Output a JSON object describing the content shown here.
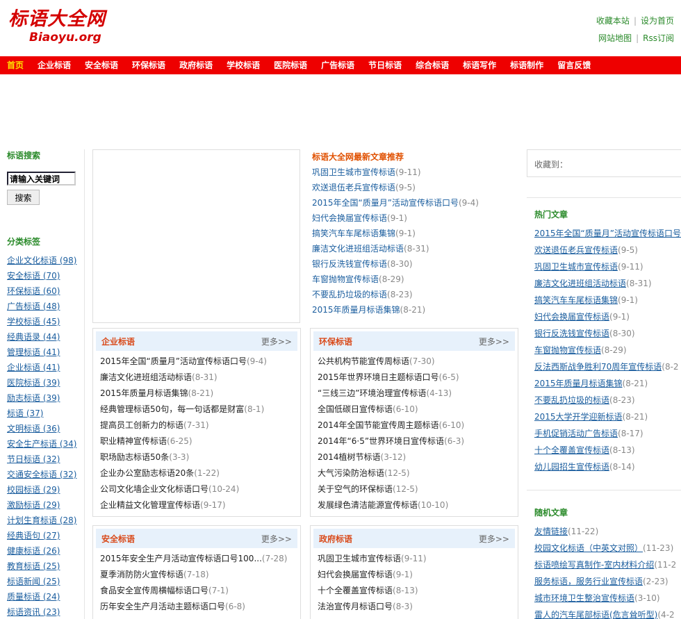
{
  "header": {
    "logo_cn": "标语大全网",
    "logo_en": "Biaoyu.org",
    "links": [
      "收藏本站",
      "设为首页",
      "网站地图",
      "Rss订阅"
    ]
  },
  "nav": [
    "首页",
    "企业标语",
    "安全标语",
    "环保标语",
    "政府标语",
    "学校标语",
    "医院标语",
    "广告标语",
    "节日标语",
    "综合标语",
    "标语写作",
    "标语制作",
    "留言反馈"
  ],
  "left": {
    "search_title": "标语搜索",
    "search_value": "请输入关键词",
    "search_button": "搜索",
    "tags_title": "分类标签",
    "tags": [
      "企业文化标语 (98)",
      "安全标语 (70)",
      "环保标语 (60)",
      "广告标语 (48)",
      "学校标语 (45)",
      "经典语录 (44)",
      "管理标语 (41)",
      "企业标语 (41)",
      "医院标语 (39)",
      "励志标语 (39)",
      "标语 (37)",
      "文明标语 (36)",
      "安全生产标语 (34)",
      "节日标语 (32)",
      "交通安全标语 (32)",
      "校园标语 (29)",
      "激励标语 (29)",
      "计划生育标语 (28)",
      "经典语句 (27)",
      "健康标语 (26)",
      "教育标语 (25)",
      "标语新闻 (25)",
      "质量标语 (24)",
      "标语资讯 (23)"
    ]
  },
  "latest": {
    "title": "标语大全网最新文章推荐",
    "items": [
      {
        "t": "巩固卫生城市宣传标语",
        "d": "(9-11)"
      },
      {
        "t": "欢送退伍老兵宣传标语",
        "d": "(9-5)"
      },
      {
        "t": "2015年全国“质量月”活动宣传标语口号",
        "d": "(9-4)"
      },
      {
        "t": "妇代会换届宣传标语",
        "d": "(9-1)"
      },
      {
        "t": "搞笑汽车车尾标语集锦",
        "d": "(9-1)"
      },
      {
        "t": "廉洁文化进班组活动标语",
        "d": "(8-31)"
      },
      {
        "t": "银行反洗钱宣传标语",
        "d": "(8-30)"
      },
      {
        "t": "车窗抛物宣传标语",
        "d": "(8-29)"
      },
      {
        "t": "不要乱扔垃圾的标语",
        "d": "(8-23)"
      },
      {
        "t": "2015年质量月标语集锦",
        "d": "(8-21)"
      }
    ]
  },
  "panels": {
    "more": "更多>>",
    "qiye": {
      "title": "企业标语",
      "items": [
        {
          "t": "2015年全国“质量月”活动宣传标语口号",
          "d": "(9-4)"
        },
        {
          "t": "廉洁文化进班组活动标语",
          "d": "(8-31)"
        },
        {
          "t": "2015年质量月标语集锦",
          "d": "(8-21)"
        },
        {
          "t": "经典管理标语50句，每一句话都是财富",
          "d": "(8-1)"
        },
        {
          "t": "提高员工创新力的标语",
          "d": "(7-31)"
        },
        {
          "t": "职业精神宣传标语",
          "d": "(6-25)"
        },
        {
          "t": "职场励志标语50条",
          "d": "(3-3)"
        },
        {
          "t": "企业办公室励志标语20条",
          "d": "(1-22)"
        },
        {
          "t": "公司文化墙企业文化标语口号",
          "d": "(10-24)"
        },
        {
          "t": "企业精益文化管理宣传标语",
          "d": "(9-17)"
        }
      ]
    },
    "huanbao": {
      "title": "环保标语",
      "items": [
        {
          "t": "公共机构节能宣传周标语",
          "d": "(7-30)"
        },
        {
          "t": "2015年世界环境日主题标语口号",
          "d": "(6-5)"
        },
        {
          "t": "“三线三边”环境治理宣传标语",
          "d": "(4-13)"
        },
        {
          "t": "全国低碳日宣传标语",
          "d": "(6-10)"
        },
        {
          "t": "2014年全国节能宣传周主题标语",
          "d": "(6-10)"
        },
        {
          "t": "2014年“6·5”世界环境日宣传标语",
          "d": "(6-3)"
        },
        {
          "t": "2014植树节标语",
          "d": "(3-12)"
        },
        {
          "t": "大气污染防治标语",
          "d": "(12-5)"
        },
        {
          "t": "关于空气的环保标语",
          "d": "(12-5)"
        },
        {
          "t": "发展绿色清洁能源宣传标语",
          "d": "(10-10)"
        }
      ]
    },
    "anquan": {
      "title": "安全标语",
      "items": [
        {
          "t": "2015年安全生产月活动宣传标语口号100...",
          "d": "(7-28)"
        },
        {
          "t": "夏季消防防火宣传标语",
          "d": "(7-18)"
        },
        {
          "t": "食品安全宣传周横幅标语口号",
          "d": "(7-1)"
        },
        {
          "t": "历年安全生产月活动主题标语口号",
          "d": "(6-8)"
        }
      ]
    },
    "zhengfu": {
      "title": "政府标语",
      "items": [
        {
          "t": "巩固卫生城市宣传标语",
          "d": "(9-11)"
        },
        {
          "t": "妇代会换届宣传标语",
          "d": "(9-1)"
        },
        {
          "t": "十个全覆盖宣传标语",
          "d": "(8-13)"
        },
        {
          "t": "法治宣传月标语口号",
          "d": "(8-3)"
        }
      ]
    }
  },
  "right": {
    "fav_label": "收藏到：",
    "hot_title": "热门文章",
    "hot": [
      {
        "t": "2015年全国“质量月”活动宣传标语口号",
        "d": ""
      },
      {
        "t": "欢送退伍老兵宣传标语",
        "d": "(9-5)"
      },
      {
        "t": "巩固卫生城市宣传标语",
        "d": "(9-11)"
      },
      {
        "t": "廉洁文化进班组活动标语",
        "d": "(8-31)"
      },
      {
        "t": "搞笑汽车车尾标语集锦",
        "d": "(9-1)"
      },
      {
        "t": "妇代会换届宣传标语",
        "d": "(9-1)"
      },
      {
        "t": "银行反洗钱宣传标语",
        "d": "(8-30)"
      },
      {
        "t": "车窗抛物宣传标语",
        "d": "(8-29)"
      },
      {
        "t": "反法西斯战争胜利70周年宣传标语",
        "d": "(8-2"
      },
      {
        "t": "2015年质量月标语集锦",
        "d": "(8-21)"
      },
      {
        "t": "不要乱扔垃圾的标语",
        "d": "(8-23)"
      },
      {
        "t": "2015大学开学迎新标语",
        "d": "(8-21)"
      },
      {
        "t": "手机促销活动广告标语",
        "d": "(8-17)"
      },
      {
        "t": "十个全覆盖宣传标语",
        "d": "(8-13)"
      },
      {
        "t": "幼儿园招生宣传标语",
        "d": "(8-14)"
      }
    ],
    "random_title": "随机文章",
    "random": [
      {
        "t": "友情链接",
        "d": "(11-22)"
      },
      {
        "t": "校园文化标语（中英文对照）",
        "d": "(11-23)"
      },
      {
        "t": "标语喷绘写真制作-室内材料介绍",
        "d": "(11-2"
      },
      {
        "t": "服务标语，服务行业宣传标语",
        "d": "(2-23)"
      },
      {
        "t": "城市环境卫生整治宣传标语",
        "d": "(3-10)"
      },
      {
        "t": "雷人的汽车尾部标语(危言耸听型)",
        "d": "(4-2"
      }
    ]
  }
}
